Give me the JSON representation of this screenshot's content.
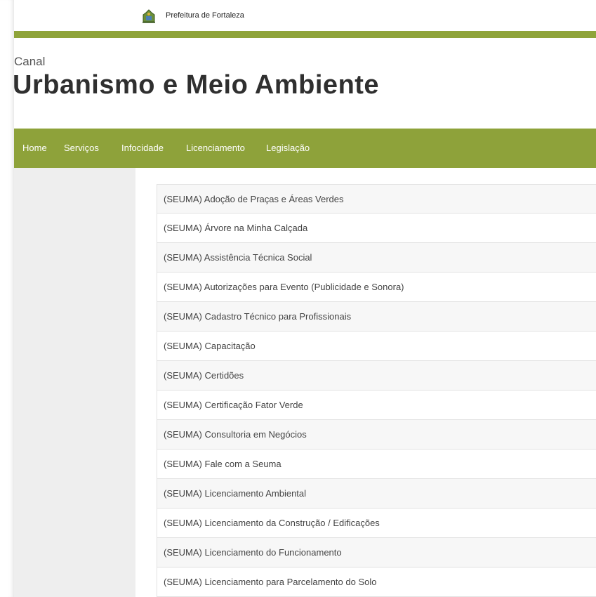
{
  "header": {
    "org_name": "Prefeitura de Fortaleza",
    "crest_icon": "city-crest-icon"
  },
  "brand": {
    "canal_label": "Canal",
    "title": "Urbanismo e Meio Ambiente"
  },
  "nav": {
    "items": [
      "Home",
      "Serviços",
      "Infocidade",
      "Licenciamento",
      "Legislação"
    ]
  },
  "services": [
    "(SEUMA) Adoção de Praças e Áreas Verdes",
    "(SEUMA) Árvore na Minha Calçada",
    "(SEUMA) Assistência Técnica Social",
    "(SEUMA) Autorizações para Evento (Publicidade e Sonora)",
    "(SEUMA) Cadastro Técnico para Profissionais",
    "(SEUMA) Capacitação",
    "(SEUMA) Certidões",
    "(SEUMA) Certificação Fator Verde",
    "(SEUMA) Consultoria em Negócios",
    "(SEUMA) Fale com a Seuma",
    "(SEUMA) Licenciamento Ambiental",
    "(SEUMA) Licenciamento da Construção / Edificações",
    "(SEUMA) Licenciamento do Funcionamento",
    "(SEUMA) Licenciamento para Parcelamento do Solo"
  ],
  "colors": {
    "accent_green": "#8ea23a",
    "sidebar_gray": "#eeeeee",
    "row_alt": "#f7f7f7"
  }
}
